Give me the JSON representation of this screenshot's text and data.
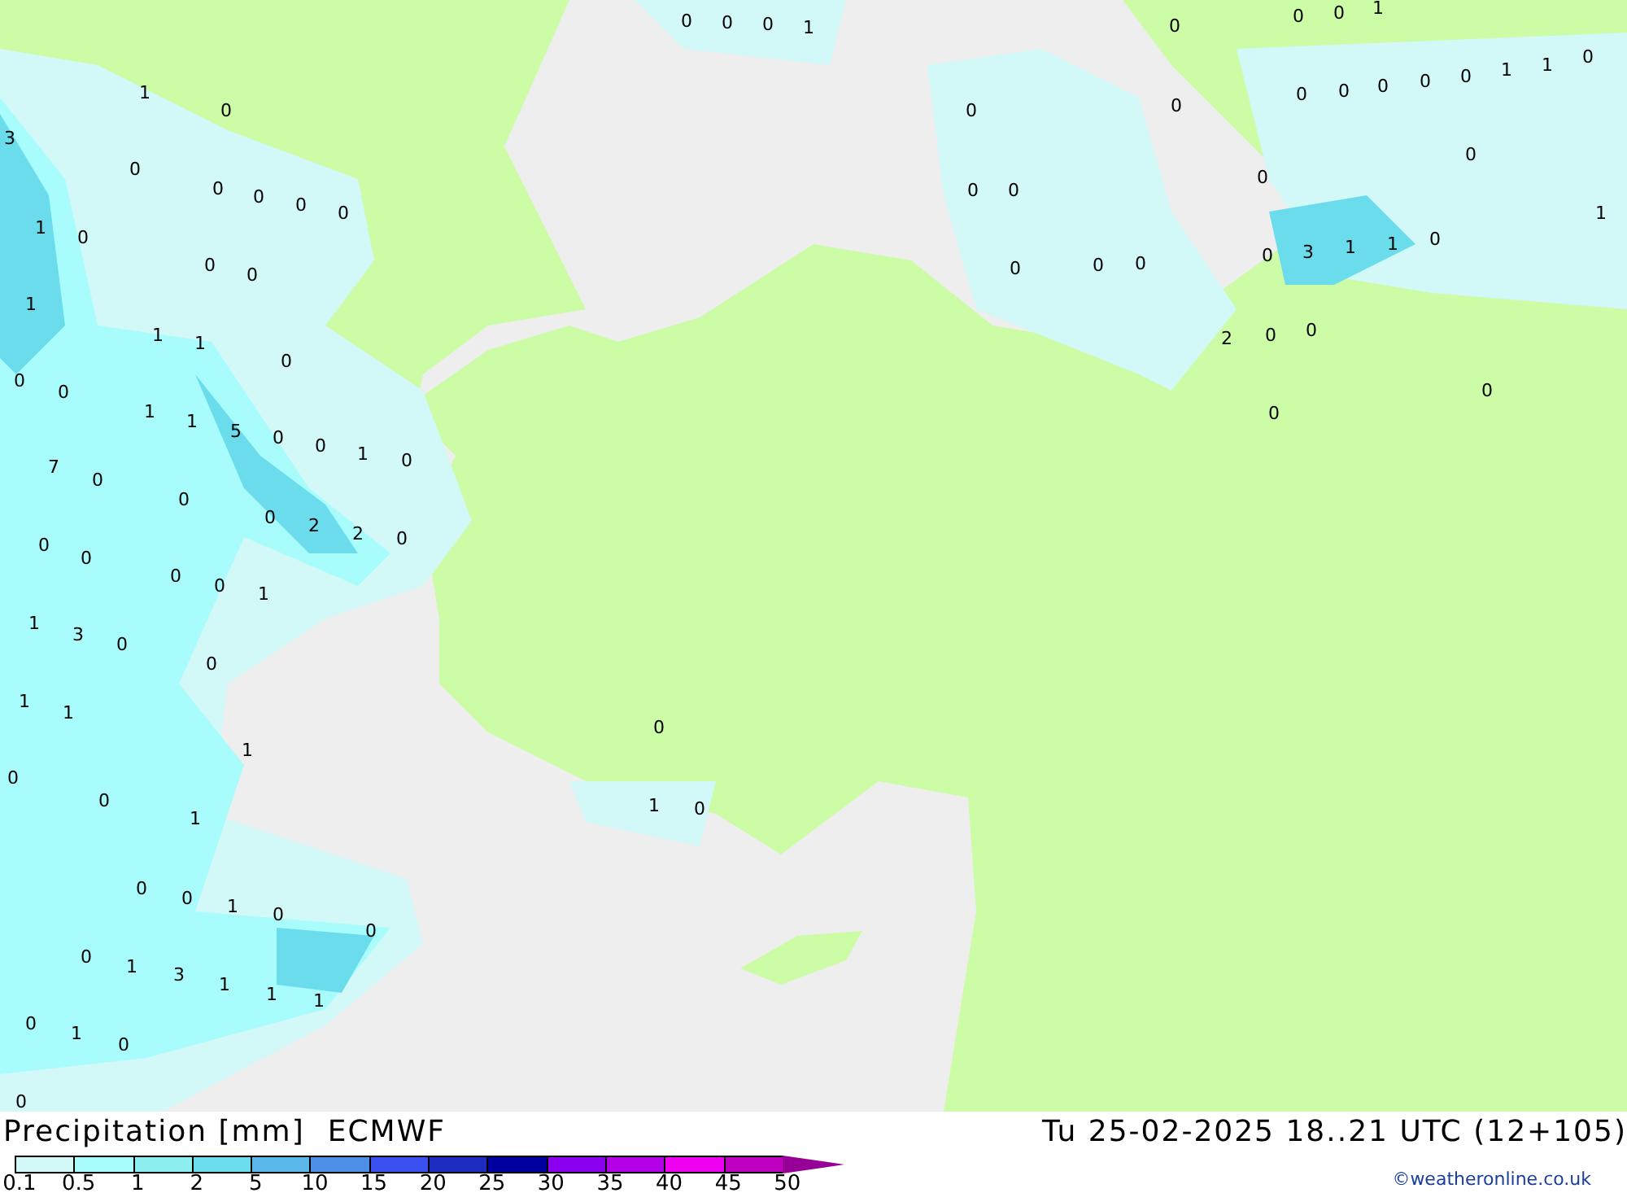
{
  "map_labels": [
    "1",
    "0",
    "3",
    "0",
    "0",
    "0",
    "0",
    "0",
    "1",
    "0",
    "0",
    "0",
    "1",
    "1",
    "1",
    "0",
    "0",
    "0",
    "1",
    "1",
    "5",
    "0",
    "0",
    "1",
    "0",
    "7",
    "0",
    "0",
    "0",
    "2",
    "2",
    "0",
    "0",
    "0",
    "0",
    "0",
    "1",
    "1",
    "3",
    "0",
    "0",
    "1",
    "1",
    "1",
    "0",
    "0",
    "1",
    "0",
    "0",
    "1",
    "0",
    "0",
    "0",
    "1",
    "3",
    "1",
    "1",
    "1",
    "0",
    "1",
    "0",
    "0",
    "0",
    "0",
    "0",
    "1",
    "0",
    "0",
    "0",
    "1",
    "0",
    "0",
    "0",
    "0",
    "0",
    "0",
    "0",
    "1",
    "1",
    "0",
    "0",
    "0",
    "0",
    "0",
    "1",
    "0",
    "0",
    "0",
    "0",
    "3",
    "1",
    "1",
    "0",
    "2",
    "0",
    "0",
    "0",
    "0",
    "0",
    "1",
    "0"
  ],
  "title": "Precipitation [mm]",
  "model": "ECMWF",
  "valid_time": "Tu 25-02-2025 18..21 UTC (12+105)",
  "legend": {
    "boxes": [
      {
        "color": "#d2f8f8"
      },
      {
        "color": "#a8fcfc"
      },
      {
        "color": "#8ceeee"
      },
      {
        "color": "#6adcec"
      },
      {
        "color": "#5ab8ea"
      },
      {
        "color": "#4e90e8"
      },
      {
        "color": "#3a50f0"
      },
      {
        "color": "#1c2cc0"
      },
      {
        "color": "#0000a0"
      },
      {
        "color": "#8c00f0"
      },
      {
        "color": "#b400e6"
      },
      {
        "color": "#f000f0"
      },
      {
        "color": "#c000c0"
      },
      {
        "kind": "arrow",
        "color": "#960096"
      }
    ],
    "ticks": [
      "0.1",
      "0.5",
      "1",
      "2",
      "5",
      "10",
      "15",
      "20",
      "25",
      "30",
      "35",
      "40",
      "45",
      "50"
    ]
  },
  "credit": "©weatheronline.co.uk"
}
